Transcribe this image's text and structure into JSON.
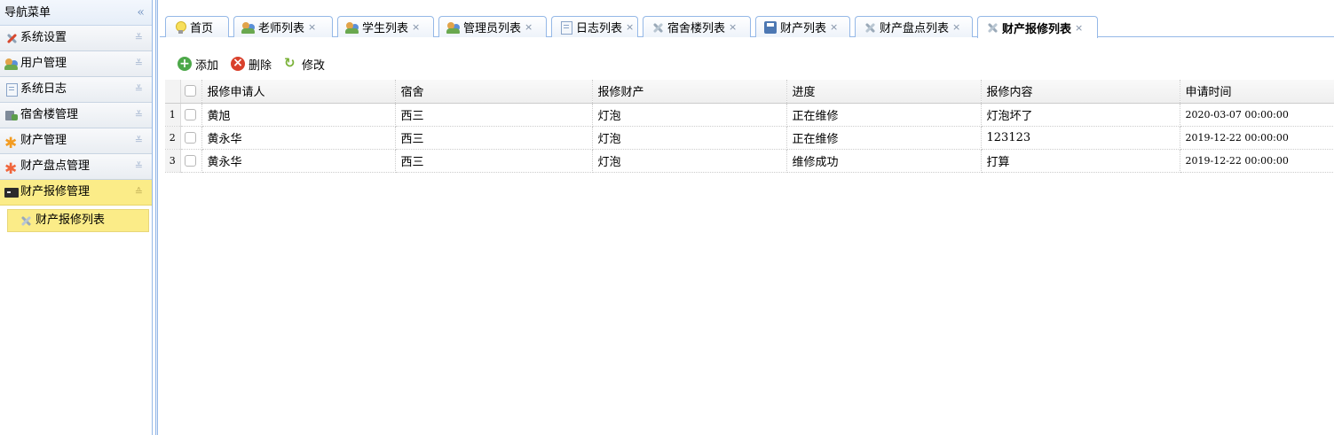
{
  "nav": {
    "title": "导航菜单",
    "collapse_glyph": "«",
    "panels": [
      {
        "label": "系统设置",
        "icon": "tools-icon",
        "expanded": false
      },
      {
        "label": "用户管理",
        "icon": "users-icon",
        "expanded": false
      },
      {
        "label": "系统日志",
        "icon": "log-icon",
        "expanded": false
      },
      {
        "label": "宿舍楼管理",
        "icon": "building-icon",
        "expanded": false
      },
      {
        "label": "财产管理",
        "icon": "asset-icon",
        "expanded": false
      },
      {
        "label": "财产盘点管理",
        "icon": "inventory-icon",
        "expanded": false
      },
      {
        "label": "财产报修管理",
        "icon": "terminal-icon",
        "expanded": true
      }
    ],
    "sub_items": [
      {
        "label": "财产报修列表",
        "icon": "tools-icon"
      }
    ],
    "chev_collapsed": "≚",
    "chev_expanded": "≙"
  },
  "tabs": [
    {
      "label": "首页",
      "icon": "bulb-icon",
      "closable": false
    },
    {
      "label": "老师列表",
      "icon": "users-icon",
      "closable": true
    },
    {
      "label": "学生列表",
      "icon": "users-icon",
      "closable": true
    },
    {
      "label": "管理员列表",
      "icon": "users-icon",
      "closable": true
    },
    {
      "label": "日志列表",
      "icon": "log-icon",
      "closable": true
    },
    {
      "label": "宿舍楼列表",
      "icon": "tools-icon",
      "closable": true
    },
    {
      "label": "财产列表",
      "icon": "save-icon",
      "closable": true
    },
    {
      "label": "财产盘点列表",
      "icon": "tools-icon",
      "closable": true
    },
    {
      "label": "财产报修列表",
      "icon": "tools-icon",
      "closable": true,
      "selected": true
    }
  ],
  "close_glyph": "×",
  "toolbar": {
    "add_label": "添加",
    "delete_label": "删除",
    "edit_label": "修改"
  },
  "grid": {
    "columns": [
      "报修申请人",
      "宿舍",
      "报修财产",
      "进度",
      "报修内容",
      "申请时间"
    ],
    "rows": [
      {
        "num": "1",
        "cells": [
          "黄旭",
          "西三",
          "灯泡",
          "正在维修",
          "灯泡坏了",
          "2020-03-07 00:00:00"
        ]
      },
      {
        "num": "2",
        "cells": [
          "黄永华",
          "西三",
          "灯泡",
          "正在维修",
          "123123",
          "2019-12-22 00:00:00"
        ]
      },
      {
        "num": "3",
        "cells": [
          "黄永华",
          "西三",
          "灯泡",
          "维修成功",
          "打算",
          "2019-12-22 00:00:00"
        ]
      }
    ]
  },
  "colors": {
    "active_highlight": "#fbec88",
    "border_blue": "#95b8e7"
  }
}
